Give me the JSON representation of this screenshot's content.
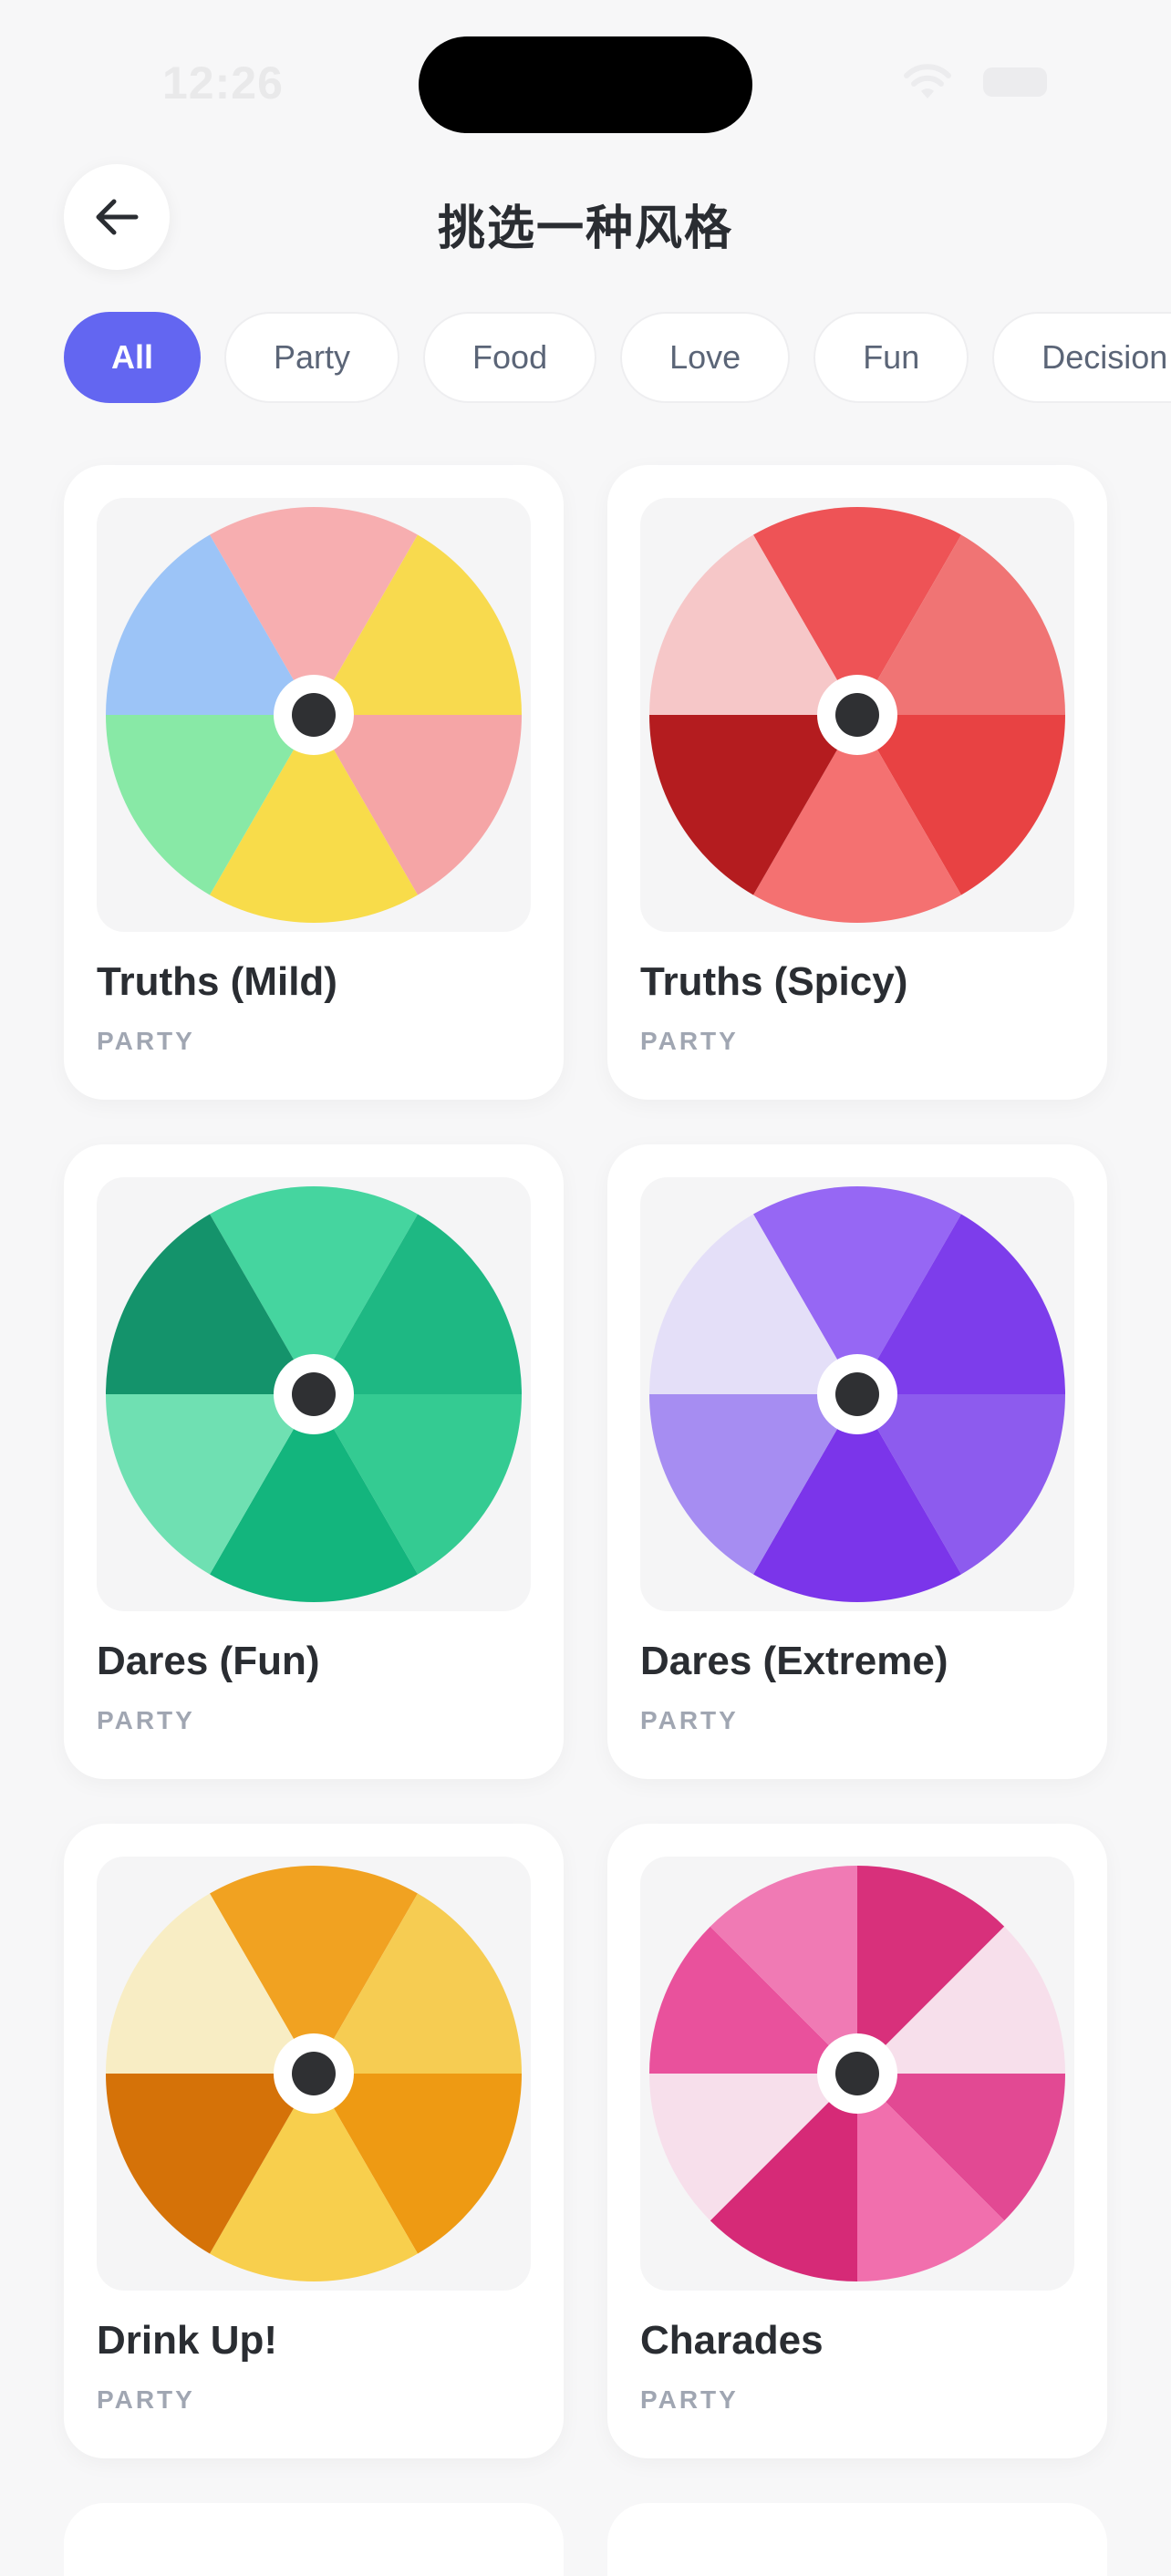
{
  "status_bar": {
    "time": "12:26"
  },
  "header": {
    "title": "挑选一种风格"
  },
  "filters": [
    "All",
    "Party",
    "Food",
    "Love",
    "Fun",
    "Decision"
  ],
  "active_filter": "All",
  "cards": [
    {
      "name": "Truths (Mild)",
      "category": "PARTY",
      "colors": [
        "#f7aeb0",
        "#f8da4e",
        "#f5a5a6",
        "#f8dc4a",
        "#88e9a6",
        "#9cc4f7"
      ]
    },
    {
      "name": "Truths (Spicy)",
      "category": "PARTY",
      "colors": [
        "#ee5356",
        "#f07474",
        "#e84243",
        "#f47171",
        "#b41c1f",
        "#f6c7c8"
      ]
    },
    {
      "name": "Dares (Fun)",
      "category": "PARTY",
      "colors": [
        "#45d59f",
        "#1eb883",
        "#34cb92",
        "#13b57d",
        "#6fe0b2",
        "#14936b"
      ]
    },
    {
      "name": "Dares (Extreme)",
      "category": "PARTY",
      "colors": [
        "#9667f4",
        "#7d3deb",
        "#8d5bee",
        "#7b35ea",
        "#a68df2",
        "#e4dff8"
      ]
    },
    {
      "name": "Drink Up!",
      "category": "PARTY",
      "colors": [
        "#f1a221",
        "#f6cc52",
        "#ee9a13",
        "#f8cf4d",
        "#d57208",
        "#f8edc4"
      ]
    },
    {
      "name": "Charades",
      "category": "PARTY",
      "colors": [
        "#d8307b",
        "#f7dfeb",
        "#e24993",
        "#f16fad",
        "#d62a77",
        "#f7dfeb",
        "#e9519c",
        "#f07ab4"
      ]
    }
  ]
}
